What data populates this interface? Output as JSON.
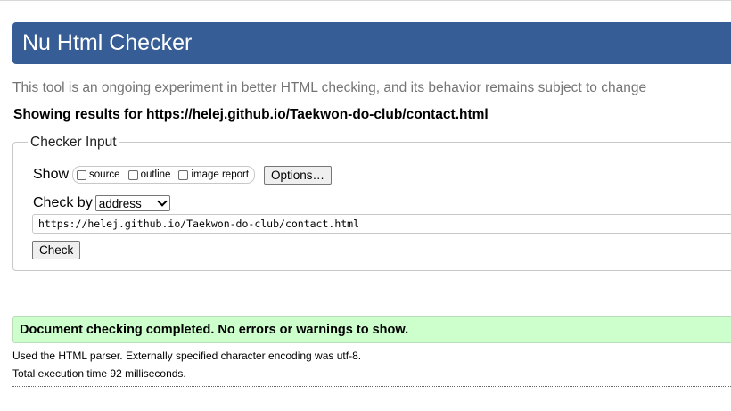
{
  "header": {
    "title": "Nu Html Checker"
  },
  "intro": "This tool is an ongoing experiment in better HTML checking, and its behavior remains subject to change",
  "results_heading": "Showing results for https://helej.github.io/Taekwon-do-club/contact.html",
  "checker": {
    "legend": "Checker Input",
    "show_label": "Show",
    "show_options": [
      "source",
      "outline",
      "image report"
    ],
    "options_button": "Options…",
    "check_by_label": "Check by",
    "check_by_value": "address",
    "url": "https://helej.github.io/Taekwon-do-club/contact.html",
    "check_button": "Check"
  },
  "result": {
    "message": "Document checking completed. No errors or warnings to show.",
    "parser_info": "Used the HTML parser. Externally specified character encoding was utf-8.",
    "timing": "Total execution time 92 milliseconds."
  },
  "colors": {
    "header_bg": "#365d95",
    "success_bg": "#ccffcc",
    "intro_text": "#747474"
  }
}
